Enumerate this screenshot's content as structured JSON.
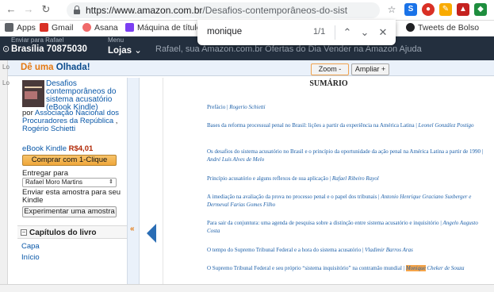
{
  "browser": {
    "url_host": "https://www.amazon.com.br",
    "url_path": "/Desafios-contemporâneos-do-sistema-acus...",
    "bookmarks": [
      {
        "label": "Apps",
        "color": "#5f6368"
      },
      {
        "label": "Gmail",
        "color": "#d93025"
      },
      {
        "label": "Asana",
        "color": "#f06a6a"
      },
      {
        "label": "Máquina de títulos",
        "color": "#7b3ff2"
      },
      {
        "label": "Tweets de Bolso",
        "color": "#202124"
      }
    ]
  },
  "find": {
    "query": "monique",
    "count": "1/1"
  },
  "amazon_header": {
    "deliver_small": "Enviar para Rafael",
    "deliver_big": "Brasília 70875030",
    "menu_small": "Menu",
    "menu_big": "Lojas",
    "nav_text": "Rafael, sua Amazon.com.br    Ofertas do Dia    Vender na Amazon    Ajuda"
  },
  "reader": {
    "de_uma": "Dê uma",
    "olhada": "Olhada!",
    "zoom_out": "Zoom -",
    "zoom_in": "Ampliar +",
    "strip_top": "Lo",
    "strip_mid": "Lo"
  },
  "sidebar": {
    "book_title": "Desafios contemporâneos do sistema acusatório (eBook Kindle)",
    "by": "por",
    "author1": "Associação Nacional dos Procuradores da República",
    "author2": "Rogério Schietti",
    "ebook_label": "eBook Kindle",
    "price": "R$4,01",
    "buy_button": "Comprar com 1-Clique",
    "send_label": "Entregar para",
    "device": "Rafael Moro Martins",
    "sample_text": "Enviar esta amostra para seu Kindle",
    "sample_button": "Experimentar uma amostra",
    "chapters_title": "Capítulos do livro",
    "chapters": [
      "Capa",
      "Início"
    ],
    "collapse_glyph": "«"
  },
  "page": {
    "heading": "SUMÁRIO",
    "toc": [
      {
        "title": "Prefácio",
        "author": "Rogerio Schietti"
      },
      {
        "title": "Bases da reforma processual penal no Brasil: lições a partir da experiência na América Latina",
        "author": "Leonel González Postigo"
      },
      {
        "title": "Os desafios do sistema acusatório no Brasil e o princípio da oportunidade da ação penal na América Latina a partir de 1990",
        "author": "André Luís Alves de Melo"
      },
      {
        "title": "Princípio acusatório e alguns reflexos de sua aplicação",
        "author": "Rafael Ribeiro Rayol"
      },
      {
        "title": "A imediação na avaliação da prova no processo penal e o papel dos tribunais",
        "author": "Antonio Henrique Graciano Suxberger e Dermeval Farias Gomes Filho"
      },
      {
        "title": "Para sair da conjuntura: uma agenda de pesquisa sobre a distinção entre sistema acusatório e inquisitório",
        "author": "Angelo Augusto Costa"
      },
      {
        "title": "O tempo do Supremo Tribunal Federal e a hora do sistema acusatório",
        "author": "Vladimir Barros Aras"
      },
      {
        "title": "O Supremo Tribunal Federal e seu próprio “sistema inquisitório” na contramão mundial",
        "author_highlight": "Monique",
        "author": "Cheker de Souza"
      }
    ]
  }
}
